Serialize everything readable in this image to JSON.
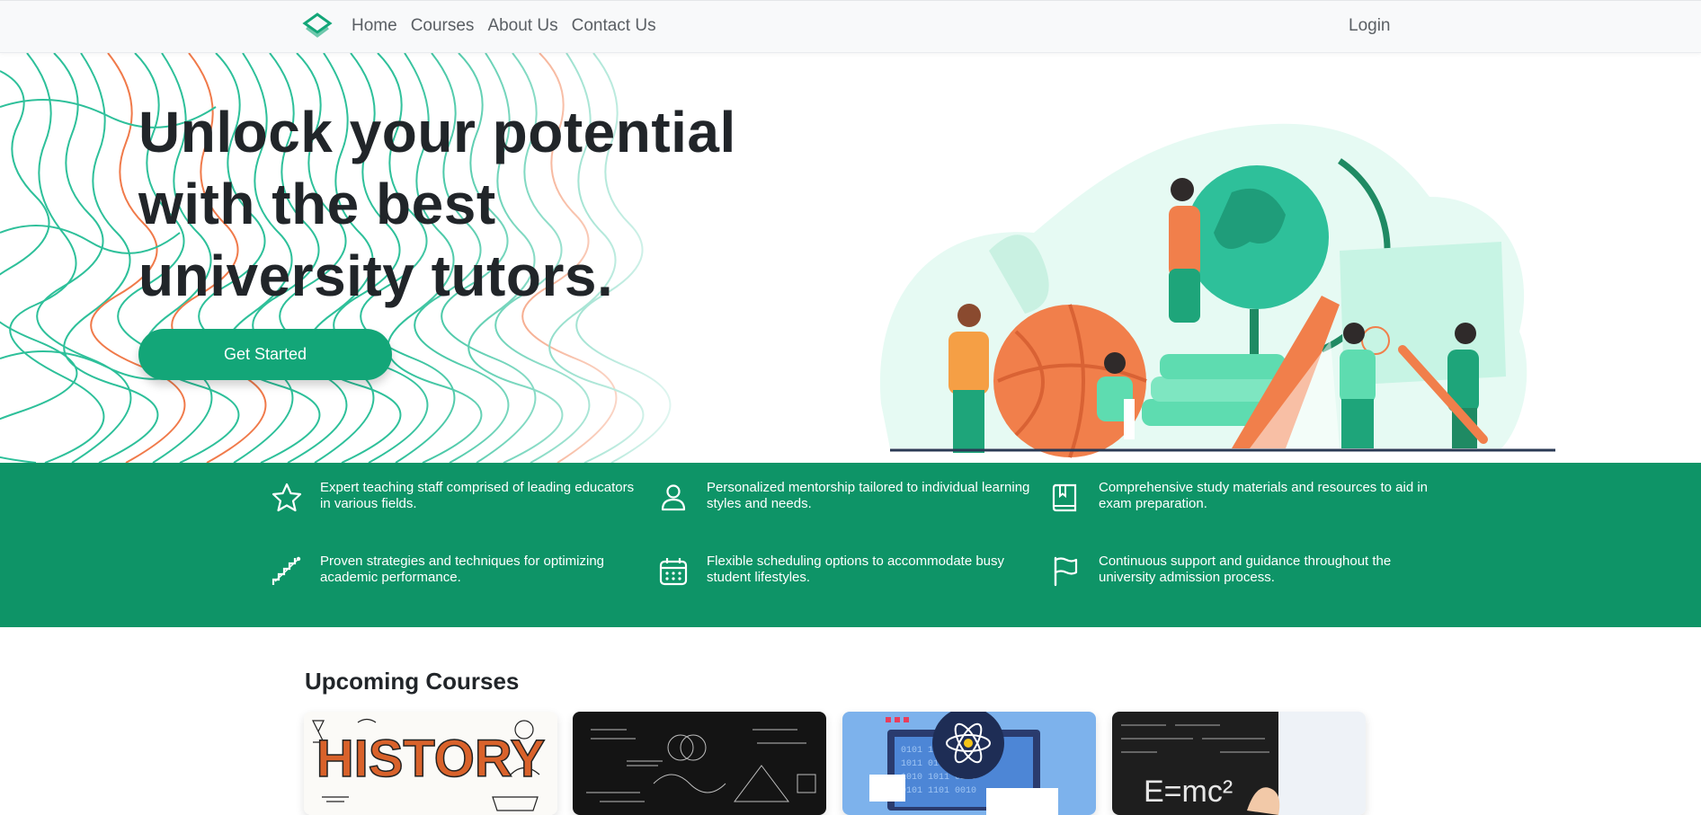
{
  "nav": {
    "brand_icon": "graduation-diamond-icon",
    "links": [
      "Home",
      "Courses",
      "About Us",
      "Contact Us"
    ],
    "login": "Login"
  },
  "hero": {
    "title_lines": [
      "Unlock your potential",
      "with the best",
      "university tutors."
    ],
    "cta": "Get Started"
  },
  "features": [
    {
      "icon": "star-icon",
      "text": "Expert teaching staff comprised of leading educators in various fields."
    },
    {
      "icon": "person-icon",
      "text": "Personalized mentorship tailored to individual learning styles and needs."
    },
    {
      "icon": "book-icon",
      "text": "Comprehensive study materials and resources to aid in exam preparation."
    },
    {
      "icon": "stairs-icon",
      "text": "Proven strategies and techniques for optimizing academic performance."
    },
    {
      "icon": "calendar-icon",
      "text": "Flexible scheduling options to accommodate busy student lifestyles."
    },
    {
      "icon": "flag-icon",
      "text": "Continuous support and guidance throughout the university admission process."
    }
  ],
  "courses": {
    "title": "Upcoming Courses",
    "cards": [
      {
        "image": "history-doodle-image",
        "art_text": "HISTORY"
      },
      {
        "image": "math-chalkboard-image"
      },
      {
        "image": "computer-science-atom-image"
      },
      {
        "image": "physics-emc2-image",
        "art_text": "E=mc²"
      }
    ]
  },
  "colors": {
    "accent": "#13a678",
    "feature_band": "#0e9467",
    "nav_bg": "#f8f9fa",
    "pattern_green": "#2ec09a",
    "pattern_orange": "#f07a4a"
  }
}
